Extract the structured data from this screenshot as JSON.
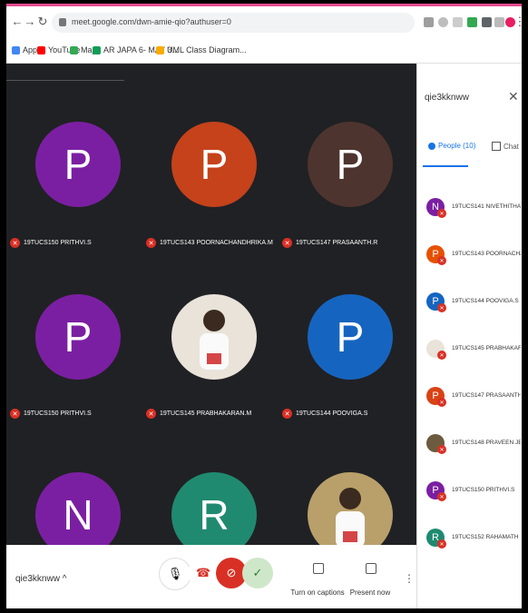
{
  "browser": {
    "url": "meet.google.com/dwn-amie-qio?authuser=0",
    "bookmarks": [
      {
        "label": "Apps",
        "color": "#4285f4"
      },
      {
        "label": "YouTube",
        "color": "#ff0000"
      },
      {
        "label": "Maps",
        "color": "#34a853"
      },
      {
        "label": "AR JAPA 6- MAY 3...",
        "color": "#0f9d58"
      },
      {
        "label": "UML Class Diagram...",
        "color": "#f9ab00"
      }
    ]
  },
  "tiles": [
    {
      "name": "19TUCS150 PRITHVI.S",
      "initial": "P",
      "color": "#7b1fa2"
    },
    {
      "name": "19TUCS143 POORNACHANDHRIKA.M",
      "initial": "P",
      "color": "#c5421b"
    },
    {
      "name": "19TUCS147 PRASAANTH.R",
      "initial": "P",
      "color": "#4e342e"
    },
    {
      "name": "19TUCS150 PRITHVI.S",
      "initial": "P",
      "color": "#7b1fa2"
    },
    {
      "name": "19TUCS145 PRABHAKARAN.M",
      "initial": "",
      "color": "#e9e3d9"
    },
    {
      "name": "19TUCS144 POOVIGA.S",
      "initial": "P",
      "color": "#1565c0"
    },
    {
      "name": "",
      "initial": "N",
      "color": "#7b1fa2"
    },
    {
      "name": "",
      "initial": "R",
      "color": "#1f8a70"
    },
    {
      "name": "",
      "initial": "",
      "color": "#b9a06a"
    }
  ],
  "meeting": {
    "code": "qie3kknww"
  },
  "controls": {
    "captions_label": "Turn on captions",
    "present_label": "Present now"
  },
  "panel": {
    "title": "qie3kknww",
    "people_tab": "People (10)",
    "chat_tab": "Chat",
    "people": [
      {
        "name": "19TUCS141 NIVETHITHA.R",
        "initial": "N",
        "color": "#7b1fa2"
      },
      {
        "name": "19TUCS143 POORNACHANDH...",
        "initial": "P",
        "color": "#e65100"
      },
      {
        "name": "19TUCS144 POOVIGA.S",
        "initial": "P",
        "color": "#1565c0"
      },
      {
        "name": "19TUCS145 PRABHAKARAN.M",
        "initial": "",
        "color": "#e9e3d9"
      },
      {
        "name": "19TUCS147 PRASAANTH.R",
        "initial": "P",
        "color": "#d84315"
      },
      {
        "name": "19TUCS148 PRAVEEN JEFFRI.S",
        "initial": "",
        "color": "#6d5b3f"
      },
      {
        "name": "19TUCS150 PRITHVI.S",
        "initial": "P",
        "color": "#7b1fa2"
      },
      {
        "name": "19TUCS152 RAHAMATH SHIH...",
        "initial": "R",
        "color": "#1f8a70"
      }
    ]
  }
}
